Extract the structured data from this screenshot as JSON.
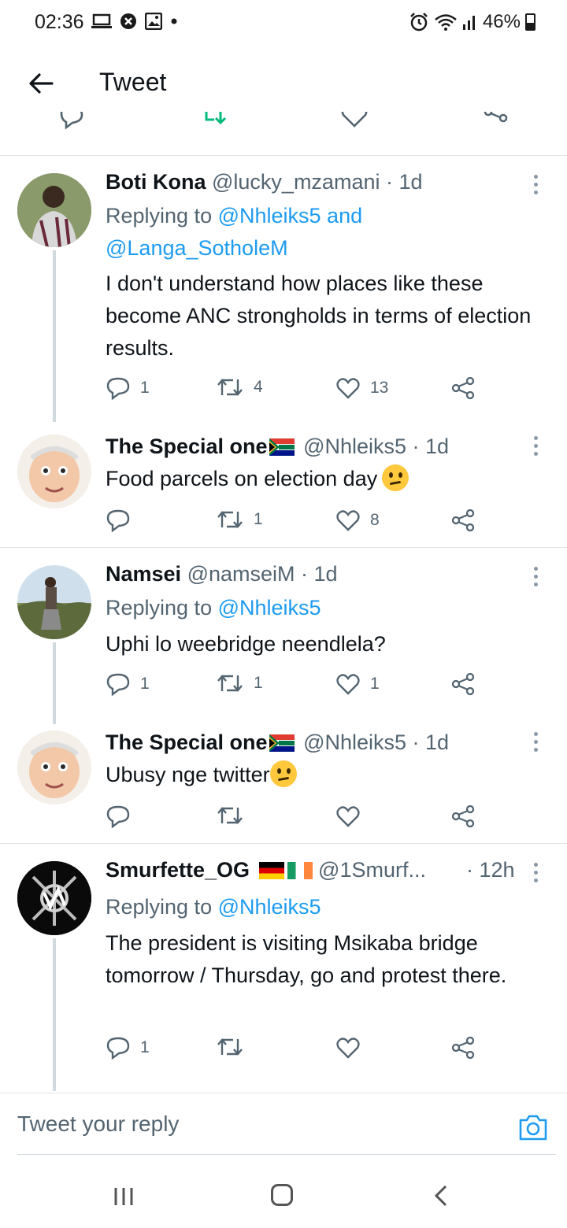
{
  "status_bar": {
    "time": "02:36",
    "battery": "46%"
  },
  "header": {
    "title": "Tweet"
  },
  "colors": {
    "link": "#1d9bf0",
    "muted": "#536471",
    "retweet_green": "#00ba7c",
    "thread_line": "#cfd9de"
  },
  "tweets": [
    {
      "name": "Boti Kona",
      "handle_time": " @lucky_mzamani · 1d",
      "reply_prefix": "Replying to ",
      "reply_mentions": "@Nhleiks5 and @Langa_SotholeM",
      "text": "I don't understand how places like these become ANC strongholds in terms of election results.",
      "replies": "1",
      "retweets": "4",
      "likes": "13"
    },
    {
      "name": "The Special one",
      "handle_time": " @Nhleiks5 · 1d",
      "text": "Food parcels on election day",
      "replies": "",
      "retweets": "1",
      "likes": "8"
    },
    {
      "name": "Namsei",
      "handle_time": " @namseiM · 1d",
      "reply_prefix": "Replying to ",
      "reply_mentions": "@Nhleiks5",
      "text": "Uphi lo weebridge neendlela?",
      "replies": "1",
      "retweets": "1",
      "likes": "1"
    },
    {
      "name": "The Special one",
      "handle_time": " @Nhleiks5 · 1d",
      "text": "Ubusy nge twitter",
      "replies": "",
      "retweets": "",
      "likes": ""
    },
    {
      "name": "Smurfette_OG ",
      "handle_time": " @1Smurf...",
      "time": "· 12h",
      "reply_prefix": "Replying to ",
      "reply_mentions": "@Nhleiks5",
      "text": "The president is visiting Msikaba bridge tomorrow / Thursday, go and protest there.",
      "replies": "1",
      "retweets": "",
      "likes": ""
    }
  ],
  "reply_bar": {
    "placeholder": "Tweet your reply"
  }
}
